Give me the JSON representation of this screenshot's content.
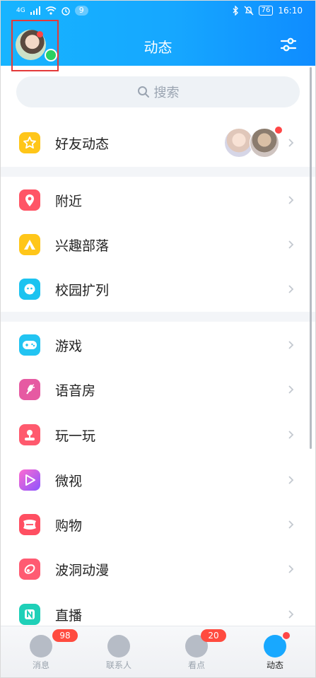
{
  "status_bar": {
    "network": "4G",
    "notification_count": "9",
    "battery": "76",
    "time": "16:10"
  },
  "header": {
    "title": "动态"
  },
  "search": {
    "placeholder": "搜索"
  },
  "list": {
    "friends_label": "好友动态",
    "nearby_label": "附近",
    "interest_label": "兴趣部落",
    "campus_label": "校园扩列",
    "games_label": "游戏",
    "voice_label": "语音房",
    "play_label": "玩一玩",
    "weishi_label": "微视",
    "shopping_label": "购物",
    "comic_label": "波洞动漫",
    "live_label": "直播"
  },
  "tabbar": {
    "messages": {
      "label": "消息",
      "badge": "98"
    },
    "contacts": {
      "label": "联系人"
    },
    "watch": {
      "label": "看点",
      "badge": "20"
    },
    "feed": {
      "label": "动态"
    }
  },
  "colors": {
    "header_blue": "#17b4ff",
    "active_blue": "#18a8ff",
    "badge_red": "#ff4b3f"
  }
}
